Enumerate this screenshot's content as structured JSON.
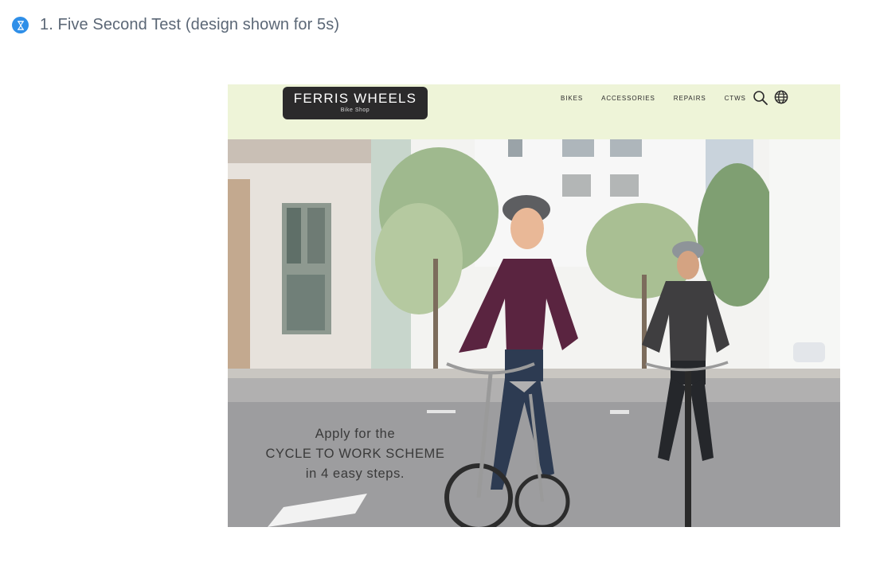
{
  "task": {
    "icon": "hourglass-icon",
    "title": "1. Five Second Test (design shown for 5s)"
  },
  "design": {
    "brand": {
      "name": "FERRIS WHEELS",
      "tagline": "Bike Shop"
    },
    "nav": {
      "links": [
        "BIKES",
        "ACCESSORIES",
        "REPAIRS",
        "CTWS"
      ],
      "icons": [
        "search-icon",
        "globe-icon"
      ]
    },
    "hero": {
      "lines": [
        "Apply for the",
        "CYCLE TO WORK SCHEME",
        "in 4 easy steps."
      ]
    },
    "colors": {
      "accent": "#2f8fe8",
      "nav_bg": "#eef4d8",
      "logo_bg": "#2b2a2b"
    }
  }
}
